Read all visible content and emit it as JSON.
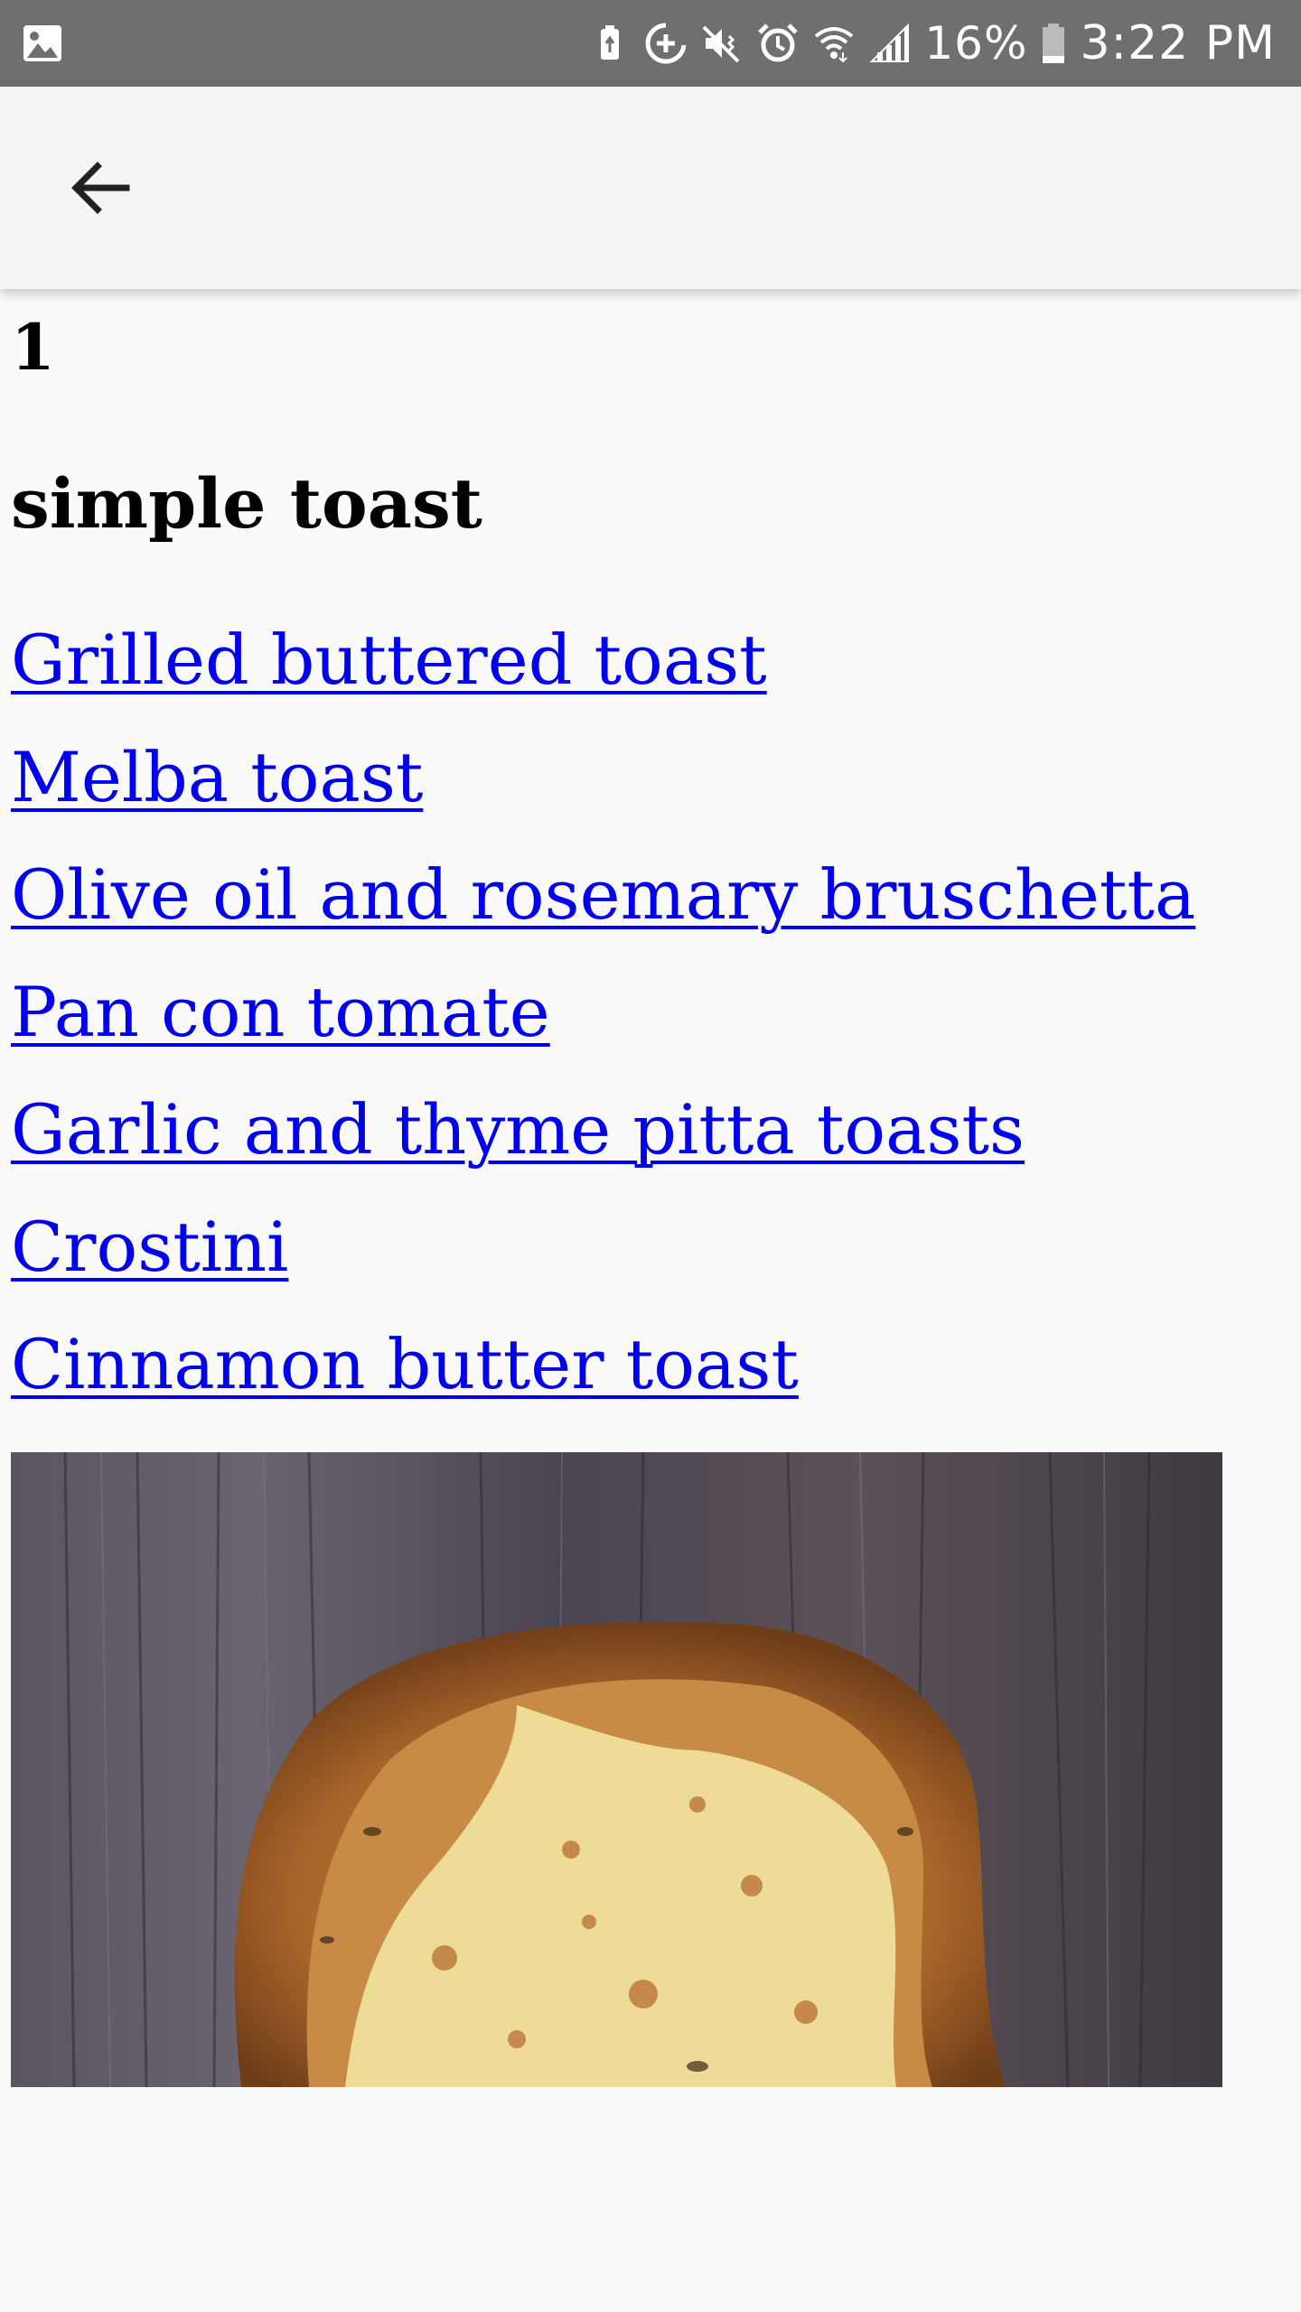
{
  "status_bar": {
    "battery_percent": "16%",
    "time": "3:22 PM",
    "icons": [
      "gallery-icon",
      "battery-saver-icon",
      "data-saver-icon",
      "vibrate-mute-icon",
      "alarm-icon",
      "wifi-icon",
      "signal-icon",
      "battery-icon"
    ]
  },
  "app_bar": {
    "back_icon": "arrow-left-icon"
  },
  "content": {
    "page_number": "1",
    "section_title": "simple toast",
    "recipes": [
      "Grilled buttered toast",
      "Melba toast",
      "Olive oil and rosemary bruschetta",
      "Pan con tomate",
      "Garlic and thyme pitta toasts",
      "Crostini",
      "Cinnamon butter toast"
    ],
    "link_color": "#0000ee"
  },
  "image": {
    "subject": "buttered-toast-photo"
  }
}
